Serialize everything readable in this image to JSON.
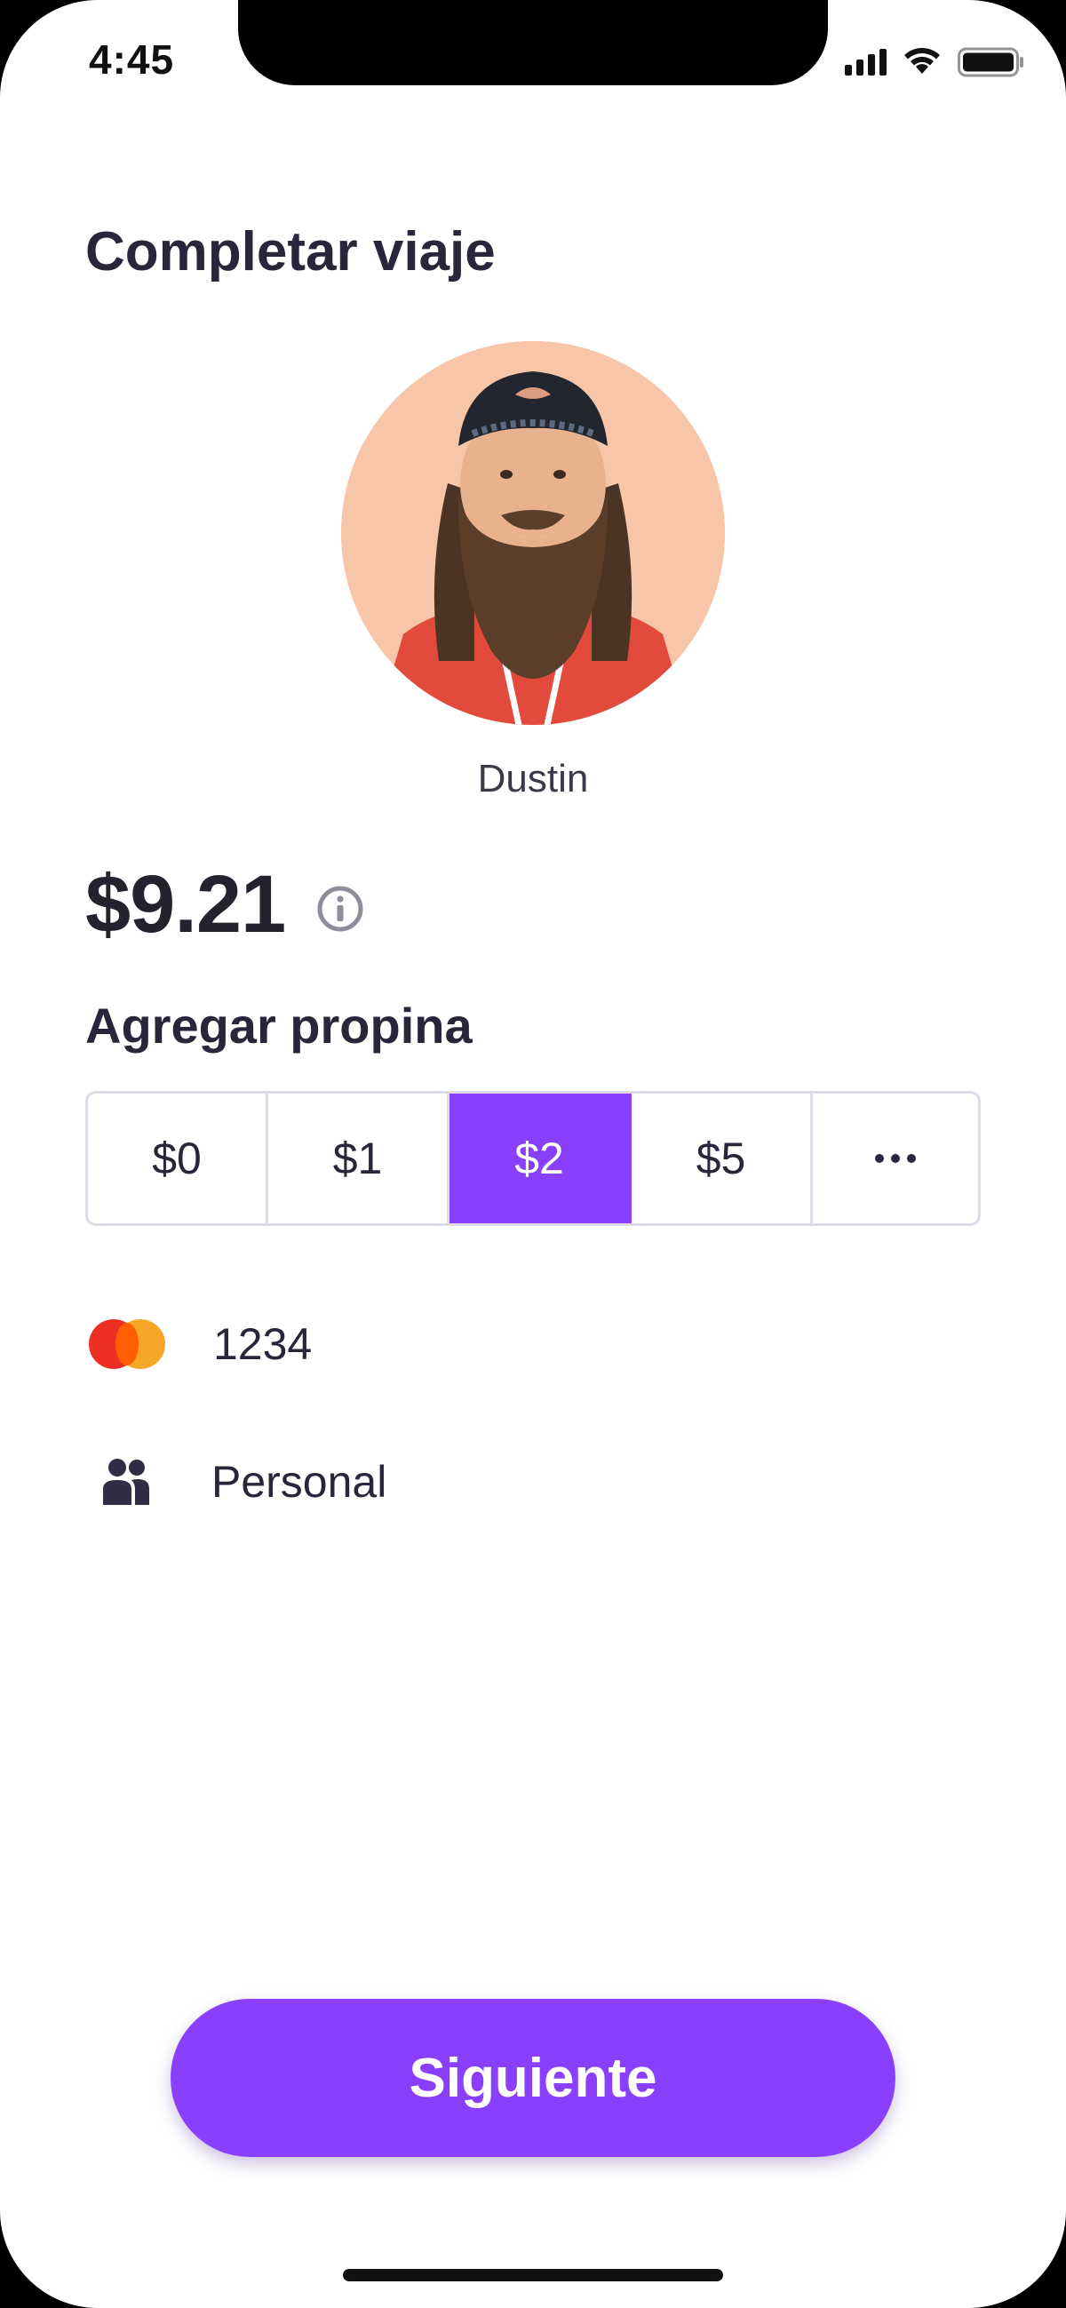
{
  "status_bar": {
    "time": "4:45"
  },
  "screen": {
    "title": "Completar viaje"
  },
  "driver": {
    "name": "Dustin",
    "avatar_background": "#f7c5a8"
  },
  "fare": {
    "amount": "$9.21",
    "info_icon": "info-icon"
  },
  "tip": {
    "heading": "Agregar propina",
    "options": [
      {
        "label": "$0",
        "selected": false
      },
      {
        "label": "$1",
        "selected": false
      },
      {
        "label": "$2",
        "selected": true
      },
      {
        "label": "$5",
        "selected": false
      },
      {
        "label": "more",
        "selected": false,
        "icon": "more-dots-icon"
      }
    ],
    "selected_color": "#8a3ffc"
  },
  "payment": {
    "icon": "mastercard-icon",
    "card_last4": "1234"
  },
  "profile": {
    "icon": "people-icon",
    "label": "Personal"
  },
  "footer": {
    "next_label": "Siguiente",
    "accent_color": "#8a3ffc"
  }
}
